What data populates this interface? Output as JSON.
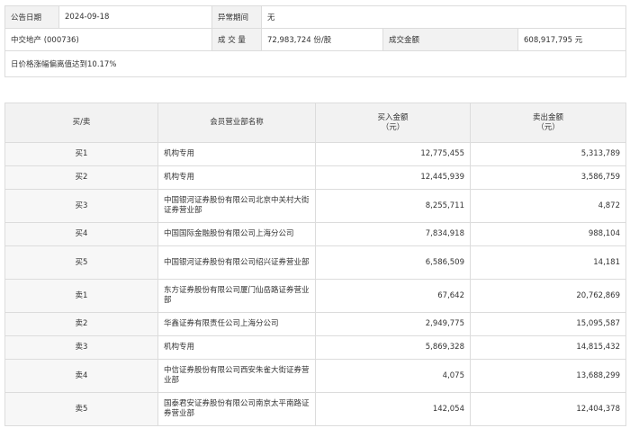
{
  "info": {
    "date_label": "公告日期",
    "date_value": "2024-09-18",
    "period_label": "异常期间",
    "period_value": "无",
    "stock": "中交地产 (000736)",
    "volume_label": "成 交 量",
    "volume_value": "72,983,724 份/股",
    "amount_label": "成交金额",
    "amount_value": "608,917,795 元",
    "reason": "日价格涨幅偏离值达到10.17%"
  },
  "table": {
    "headers": {
      "side": "买/卖",
      "dept": "会员营业部名称",
      "buy_line1": "买入金额",
      "buy_line2": "（元）",
      "sell_line1": "卖出金额",
      "sell_line2": "（元）"
    },
    "rows": [
      {
        "side": "买1",
        "dept": "机构专用",
        "buy": "12,775,455",
        "sell": "5,313,789"
      },
      {
        "side": "买2",
        "dept": "机构专用",
        "buy": "12,445,939",
        "sell": "3,586,759"
      },
      {
        "side": "买3",
        "dept": "中国银河证券股份有限公司北京中关村大街证券营业部",
        "buy": "8,255,711",
        "sell": "4,872"
      },
      {
        "side": "买4",
        "dept": "中国国际金融股份有限公司上海分公司",
        "buy": "7,834,918",
        "sell": "988,104"
      },
      {
        "side": "买5",
        "dept": "中国银河证券股份有限公司绍兴证券营业部",
        "buy": "6,586,509",
        "sell": "14,181"
      },
      {
        "side": "卖1",
        "dept": "东方证券股份有限公司厦门仙岳路证券营业部",
        "buy": "67,642",
        "sell": "20,762,869"
      },
      {
        "side": "卖2",
        "dept": "华鑫证券有限责任公司上海分公司",
        "buy": "2,949,775",
        "sell": "15,095,587"
      },
      {
        "side": "卖3",
        "dept": "机构专用",
        "buy": "5,869,328",
        "sell": "14,815,432"
      },
      {
        "side": "卖4",
        "dept": "中信证券股份有限公司西安朱雀大街证券营业部",
        "buy": "4,075",
        "sell": "13,688,299"
      },
      {
        "side": "卖5",
        "dept": "国泰君安证券股份有限公司南京太平南路证券营业部",
        "buy": "142,054",
        "sell": "12,404,378"
      }
    ]
  }
}
